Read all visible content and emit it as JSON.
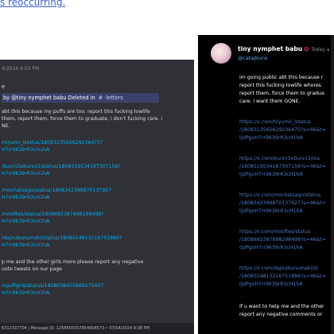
{
  "caption": "s reoccurring.",
  "left": {
    "timestamp": "4/2024 9:03 PM",
    "label_e": "e",
    "deleted_by_prefix": "by ",
    "username": "@tiny nymphet babu",
    "deleted_in": " Deleted in ",
    "channel": "# ·letters",
    "body_lines": [
      "abt this because my puffs are too. report this fucking lowlife",
      "them, report them, force them to graduate, i don't fucking care. i",
      "NE."
    ],
    "links": [
      "miyumi_/status/1808313565629236475?",
      "H7rr9639rR3cH1hA",
      "/bunni3xbunni3/status/1808519534187307156?",
      "H7rr9639rR3cH1hA",
      "/mochatsago/status/1808342399870137927",
      "H7rr9639rR3cH1hA",
      "/mooftes/status/1808692387998298498?",
      "H7rr9639rR3cH1hA",
      "/dajoubunumaki/status/1808554813216751886?",
      "H7rr9639rR3cH1hA"
    ],
    "tail_lines": [
      "p me and the other girls more please report any negative",
      "uote tweets on our page"
    ],
    "final_links": [
      "icpuffgirls/status/1808038455669275437",
      "H7rr9639rR3cH1hA"
    ],
    "footer": "6312337704 | Message ID: 1258550337954904573 • 07/04/2024 9:08 PM"
  },
  "right": {
    "name": "tiny nymphet babu",
    "badge": "✿",
    "time": "Today a",
    "handle": "@catajbuns",
    "body_lines": [
      "im going public abt this because r",
      "report this fucking lowlife whores",
      "report them, force them to gradua",
      "care. i want them GONE."
    ],
    "links": [
      "https://x.com/hiyumii_/status",
      "/1808313565629236475?s=46&t=",
      "tjdPgxH7rr9639rR3cH1hA",
      "https://x.com/bunni3xbunni3/sta",
      "/1808519534187307156?s=46&t=",
      "tjdPgxH7rr9639rR3cH1hA",
      "https://x.com/mochatsago/status",
      "/1808342399870137927?s=46&t=",
      "tjdPgxH7rr9639rR3cH1hA",
      "https://x.com/mooftes/status",
      "/1808692387998298498?s=46&t=",
      "tjdPgxH7rr9639rR3cH1hA",
      "https://x.com/dajoubunumaki/st",
      "/1808554813216751886?s=46&t=",
      "tjdPgxH7rr9639rR3cH1hA"
    ],
    "tail_lines": [
      "if u want to help me and the other",
      "report any negative comments or"
    ]
  }
}
